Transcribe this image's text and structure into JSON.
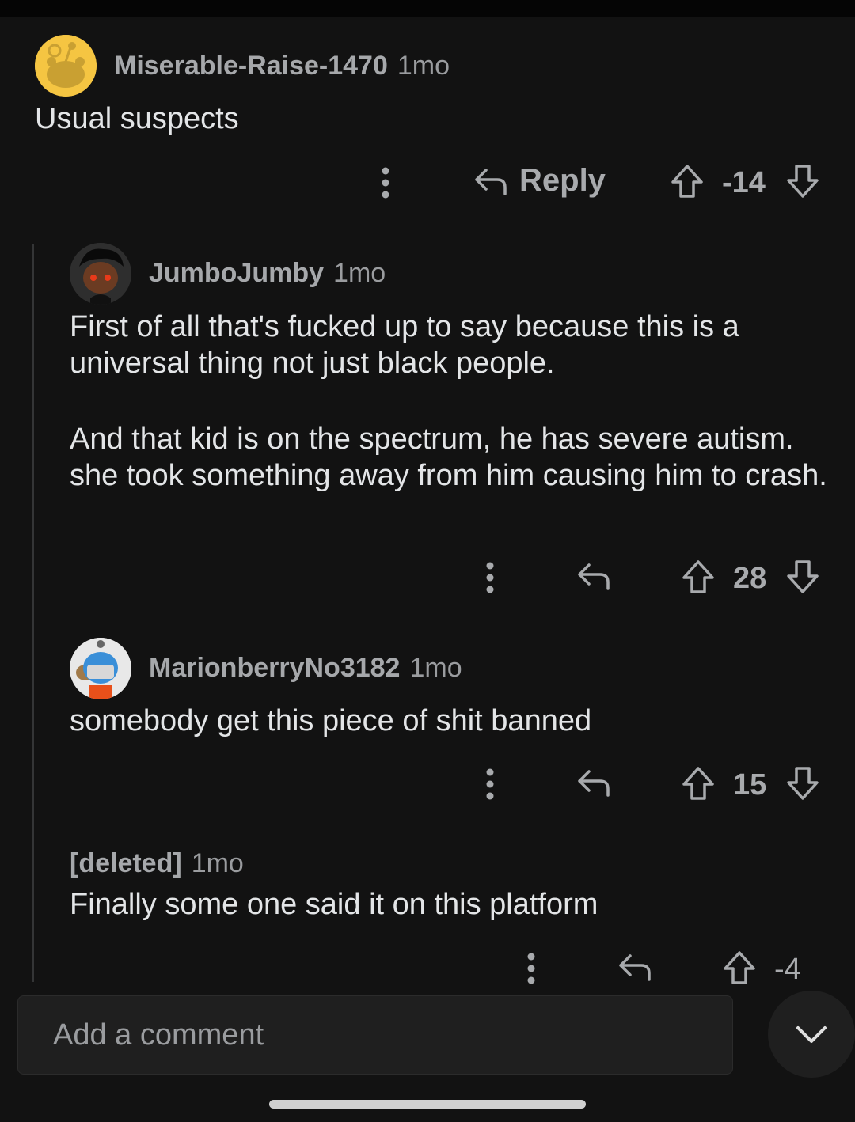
{
  "comments": [
    {
      "username": "Miserable-Raise-1470",
      "time": "1mo",
      "text": "Usual suspects",
      "reply_label": "Reply",
      "score": "-14",
      "avatar_color": "#f5c542"
    },
    {
      "username": "JumboJumby",
      "time": "1mo",
      "paragraphs": [
        "First of all that's fucked up to say because this is a universal thing not just black people.",
        "And that kid is on the spectrum, he has severe autism. she took something away from him causing him to crash."
      ],
      "score": "28",
      "avatar_color": "#2b2b2b"
    },
    {
      "username": "MarionberryNo3182",
      "time": "1mo",
      "text": "somebody get this piece of shit banned",
      "score": "15",
      "avatar_color": "#e6e6e6"
    },
    {
      "username": "[deleted]",
      "time": "1mo",
      "text": "Finally some one said it on this platform",
      "score": "-4"
    }
  ],
  "composer": {
    "placeholder": "Add a comment"
  },
  "icons": {
    "more": "more-vertical-icon",
    "reply": "reply-arrow-icon",
    "upvote": "upvote-arrow-icon",
    "downvote": "downvote-arrow-icon",
    "collapse": "chevron-down-icon"
  },
  "colors": {
    "background": "#121212",
    "text": "#e3e5e7",
    "meta": "#a6a8ab"
  }
}
